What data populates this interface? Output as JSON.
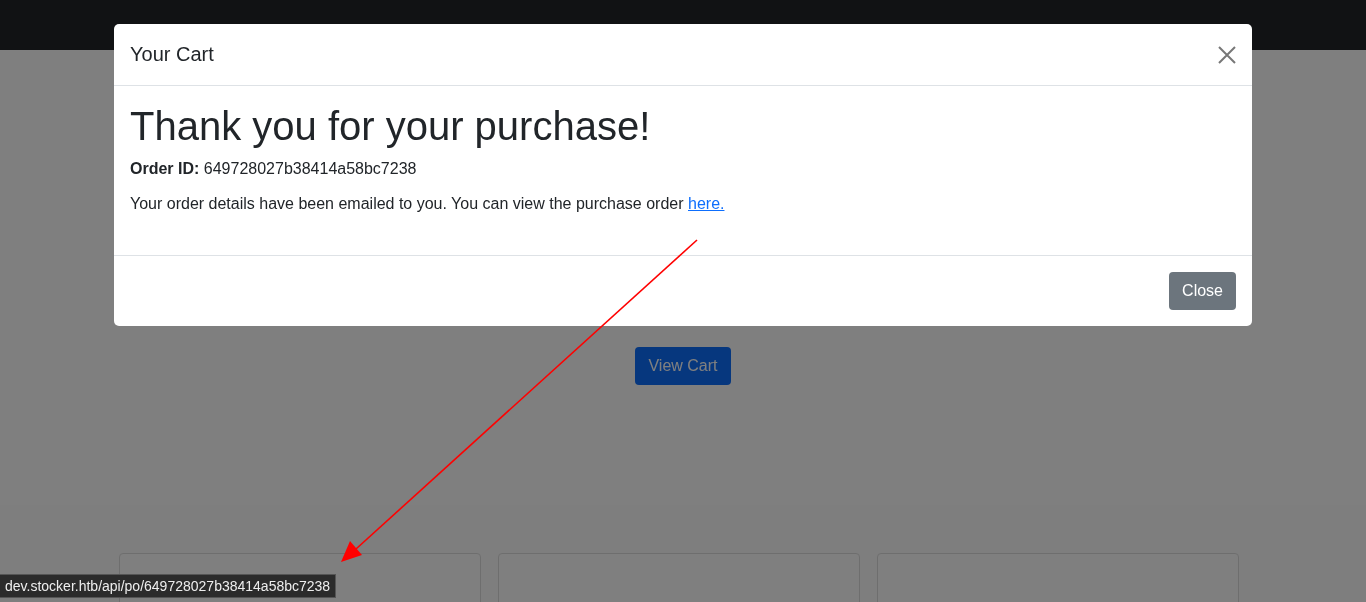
{
  "page": {
    "view_cart": "View Cart"
  },
  "modal": {
    "title": "Your Cart",
    "heading": "Thank you for your purchase!",
    "order_label": "Order ID:",
    "order_id": "649728027b38414a58bc7238",
    "message": "Your order details have been emailed to you. You can view the purchase order ",
    "link": "here.",
    "close": "Close"
  },
  "status_url": "dev.stocker.htb/api/po/649728027b38414a58bc7238"
}
